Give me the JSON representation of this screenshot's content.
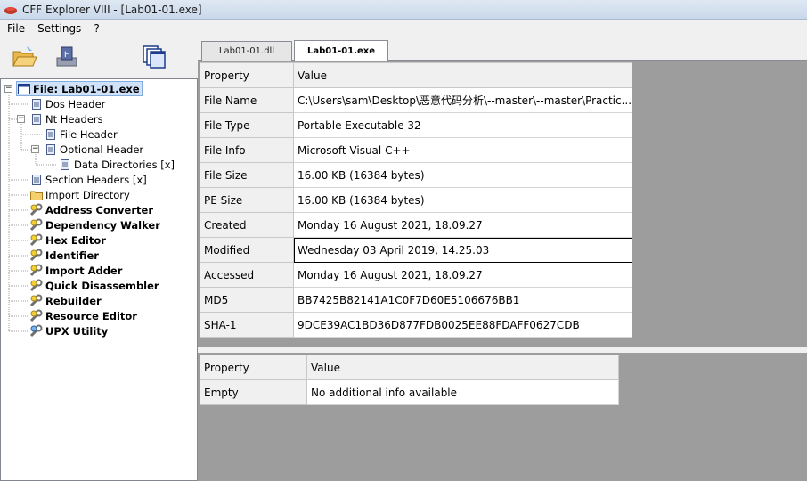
{
  "window": {
    "title": "CFF Explorer VIII - [Lab01-01.exe]"
  },
  "menu": [
    "File",
    "Settings",
    "?"
  ],
  "toolbar": [
    {
      "name": "open-file-button",
      "icon": "folder-open-icon"
    },
    {
      "name": "save-file-button",
      "icon": "save-disk-icon"
    },
    {
      "name": "windows-button",
      "icon": "cascade-windows-icon"
    }
  ],
  "tree": {
    "root": "File: Lab01-01.exe",
    "items": [
      "Dos Header",
      "Nt Headers",
      "File Header",
      "Optional Header",
      "Data Directories [x]",
      "Section Headers [x]",
      "Import Directory",
      "Address Converter",
      "Dependency Walker",
      "Hex Editor",
      "Identifier",
      "Import Adder",
      "Quick Disassembler",
      "Rebuilder",
      "Resource Editor",
      "UPX Utility"
    ]
  },
  "tabs": [
    "Lab01-01.dll",
    "Lab01-01.exe"
  ],
  "main_table": {
    "headers": [
      "Property",
      "Value"
    ],
    "rows": [
      [
        "File Name",
        "C:\\Users\\sam\\Desktop\\恶意代码分析\\--master\\--master\\Practic..."
      ],
      [
        "File Type",
        "Portable Executable 32"
      ],
      [
        "File Info",
        "Microsoft Visual C++"
      ],
      [
        "File Size",
        "16.00 KB (16384 bytes)"
      ],
      [
        "PE Size",
        "16.00 KB (16384 bytes)"
      ],
      [
        "Created",
        "Monday 16 August 2021, 18.09.27"
      ],
      [
        "Modified",
        "Wednesday 03 April 2019, 14.25.03"
      ],
      [
        "Accessed",
        "Monday 16 August 2021, 18.09.27"
      ],
      [
        "MD5",
        "BB7425B82141A1C0F7D60E5106676BB1"
      ],
      [
        "SHA-1",
        "9DCE39AC1BD36D877FDB0025EE88FDAFF0627CDB"
      ]
    ]
  },
  "info_table": {
    "headers": [
      "Property",
      "Value"
    ],
    "rows": [
      [
        "Empty",
        "No additional info available"
      ]
    ]
  }
}
